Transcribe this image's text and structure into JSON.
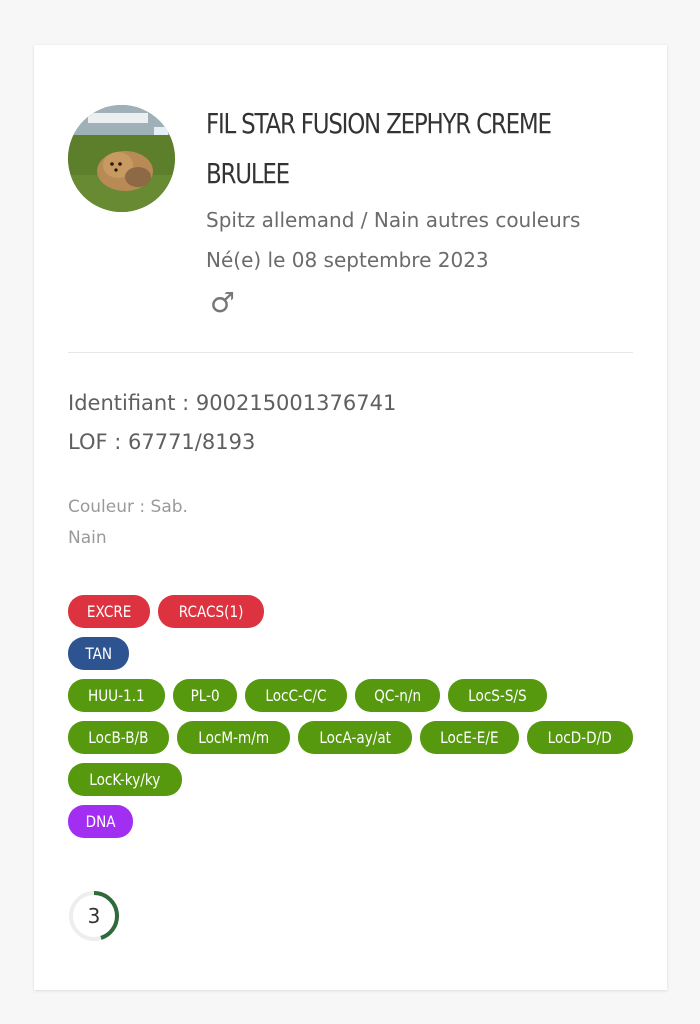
{
  "dog": {
    "name": "FIL STAR FUSION ZEPHYR CREME BRULEE",
    "breed": "Spitz allemand / Nain autres couleurs",
    "birth": "Né(e) le 08 septembre 2023",
    "sex_symbol": "♂",
    "sex_icon": "male-icon"
  },
  "ids": {
    "identifiant": "Identifiant : 900215001376741",
    "lof": "LOF : 67771/8193"
  },
  "details": {
    "couleur": "Couleur : Sab.",
    "taille": "Nain"
  },
  "tags": {
    "row1": [
      "EXCRE",
      "RCACS(1)"
    ],
    "row2": [
      "TAN"
    ],
    "row3": [
      "HUU-1.1",
      "PL-0",
      "LocC-C/C",
      "QC-n/n",
      "LocS-S/S"
    ],
    "row4": [
      "LocB-B/B",
      "LocM-m/m",
      "LocA-ay/at",
      "LocE-E/E",
      "LocD-D/D"
    ],
    "row5": [
      "LocK-ky/ky"
    ],
    "row6": [
      "DNA"
    ]
  },
  "score": {
    "value": "3",
    "fraction": 0.45
  },
  "colors": {
    "red": "#dd3340",
    "blue": "#2e5391",
    "green": "#56990f",
    "purple": "#a22ef2",
    "ring": "#2f6b3a"
  }
}
